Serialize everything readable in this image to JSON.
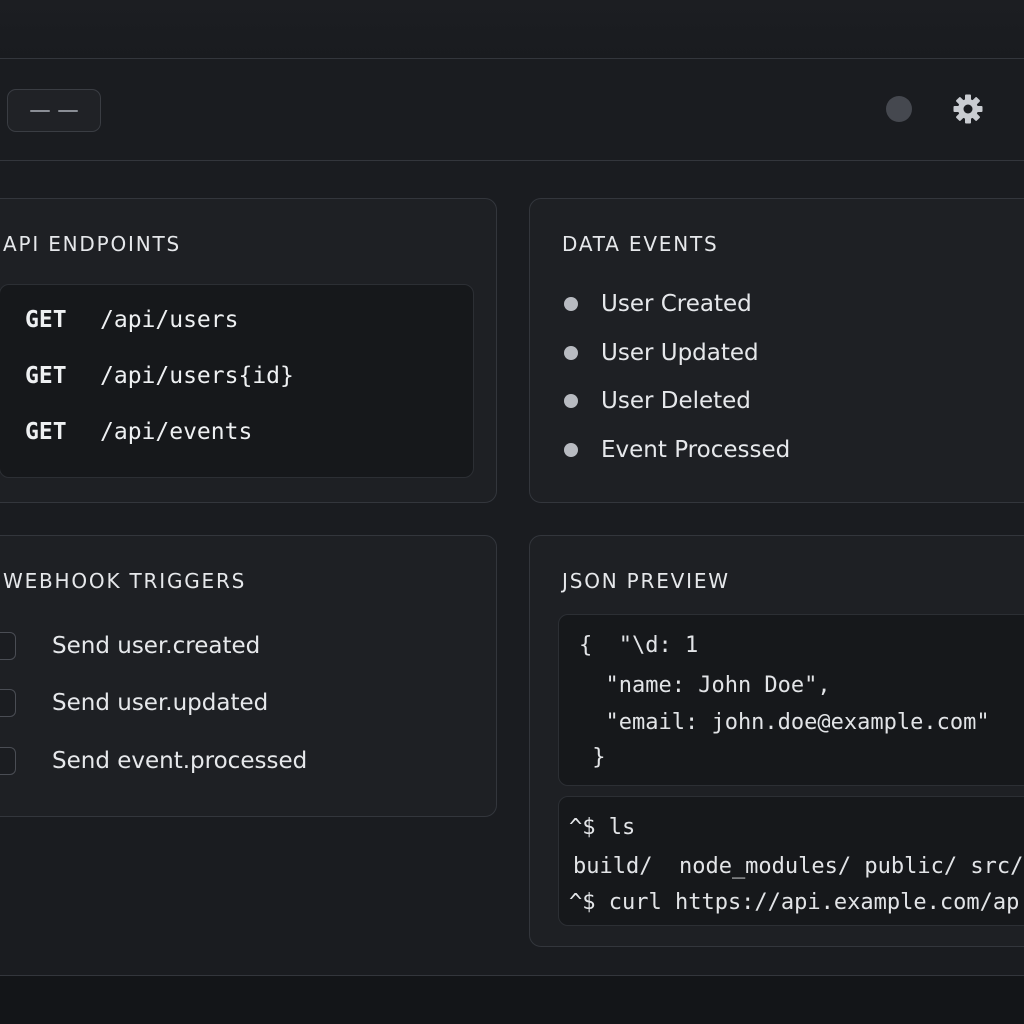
{
  "header": {
    "menu_icon": "menu-icon",
    "status_icon": "status-dot-icon",
    "settings_icon": "gear-icon"
  },
  "api_endpoints": {
    "title": "API ENDPOINTS",
    "items": [
      {
        "method": "GET",
        "path": "/api/users"
      },
      {
        "method": "GET",
        "path": "/api/users{id}"
      },
      {
        "method": "GET",
        "path": "/api/events"
      }
    ]
  },
  "data_events": {
    "title": "DATA EVENTS",
    "items": [
      "User Created",
      "User Updated",
      "User Deleted",
      "Event Processed"
    ]
  },
  "webhook_triggers": {
    "title": "WEBHOOK TRIGGERS",
    "items": [
      "Send user.created",
      "Send user.updated",
      "Send event.processed"
    ]
  },
  "json_preview": {
    "title": "JSON PREVIEW",
    "lines": [
      "{  \"\\d: 1",
      "  \"name: John Doe\",",
      "  \"email: john.doe@example.com\"",
      " }"
    ]
  },
  "terminal": {
    "lines": [
      "^$ ls",
      "build/  node_modules/ public/ src/",
      "^$ curl https://api.example.com/ap"
    ]
  },
  "colors": {
    "background": "#141619",
    "card": "#1e2024",
    "border": "#33363c",
    "text": "#e6e8eb",
    "bullet": "#b8bbc1"
  }
}
